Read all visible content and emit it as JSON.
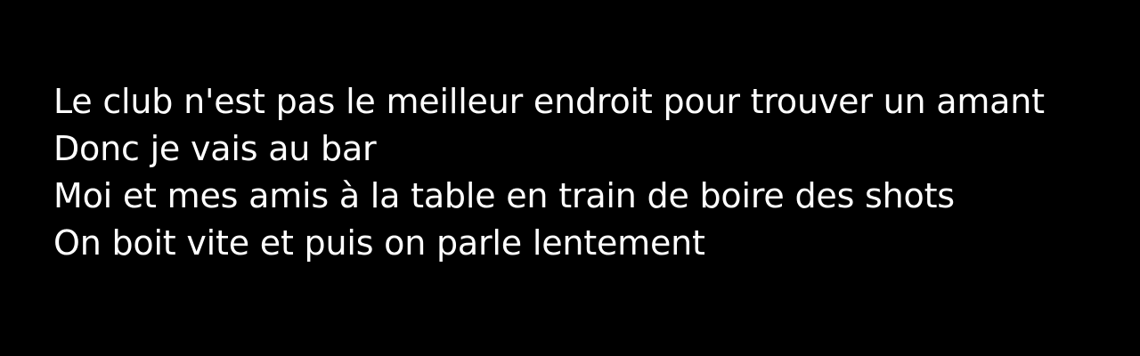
{
  "lyrics": {
    "lines": [
      "Le club n'est pas le meilleur endroit pour trouver un amant",
      "Donc je vais au bar",
      "Moi et mes amis à la table en train de boire des shots",
      "On boit vite et puis on parle lentement"
    ]
  },
  "colors": {
    "background": "#000000",
    "text": "#ffffff"
  }
}
